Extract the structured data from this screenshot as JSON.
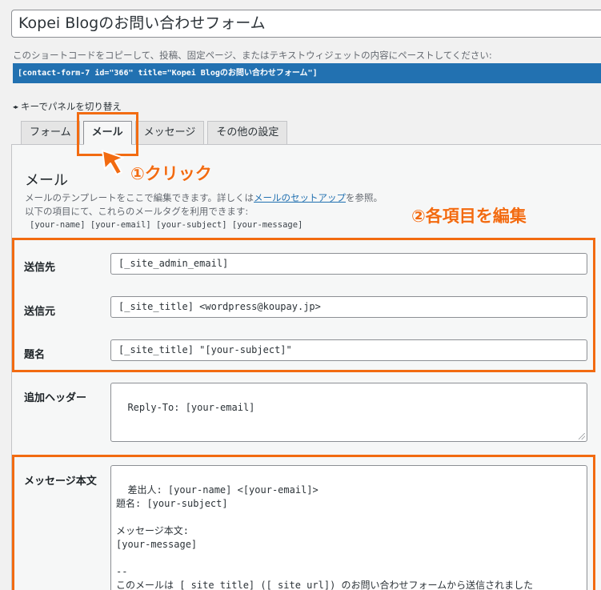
{
  "form": {
    "title": "Kopei Blogのお問い合わせフォーム",
    "shortcode_hint": "このショートコードをコピーして、投稿、固定ページ、またはテキストウィジェットの内容にペーストしてください:",
    "shortcode": "[contact-form-7 id=\"366\" title=\"Kopei Blogのお問い合わせフォーム\"]",
    "keyboard_hint": "キーでパネルを切り替え"
  },
  "tabs": [
    {
      "label": "フォーム"
    },
    {
      "label": "メール",
      "active": true
    },
    {
      "label": "メッセージ"
    },
    {
      "label": "その他の設定"
    }
  ],
  "mail": {
    "heading": "メール",
    "desc_before_link": "メールのテンプレートをここで編集できます。詳しくは",
    "desc_link": "メールのセットアップ",
    "desc_after_link": "を参照。",
    "desc_line2": "以下の項目にて、これらのメールタグを利用できます:",
    "tags": "[your-name] [your-email] [your-subject] [your-message]",
    "fields": {
      "to_label": "送信先",
      "to_value": "[_site_admin_email]",
      "from_label": "送信元",
      "from_value": "[_site_title] <wordpress@koupay.jp>",
      "subject_label": "題名",
      "subject_value": "[_site_title] \"[your-subject]\"",
      "headers_label": "追加ヘッダー",
      "headers_value": "Reply-To: [your-email]",
      "body_label": "メッセージ本文",
      "body_value": "差出人: [your-name] <[your-email]>\n題名: [your-subject]\n\nメッセージ本文:\n[your-message]\n\n-- \nこのメールは [_site_title] ([_site_url]) のお問い合わせフォームから送信されました"
    }
  },
  "annotations": {
    "click": "①クリック",
    "edit": "②各項目を編集",
    "color": "#f26b11"
  },
  "icons": {
    "keyboard_arrows": "◂▸",
    "pointer": "arrow-pointer-icon"
  }
}
